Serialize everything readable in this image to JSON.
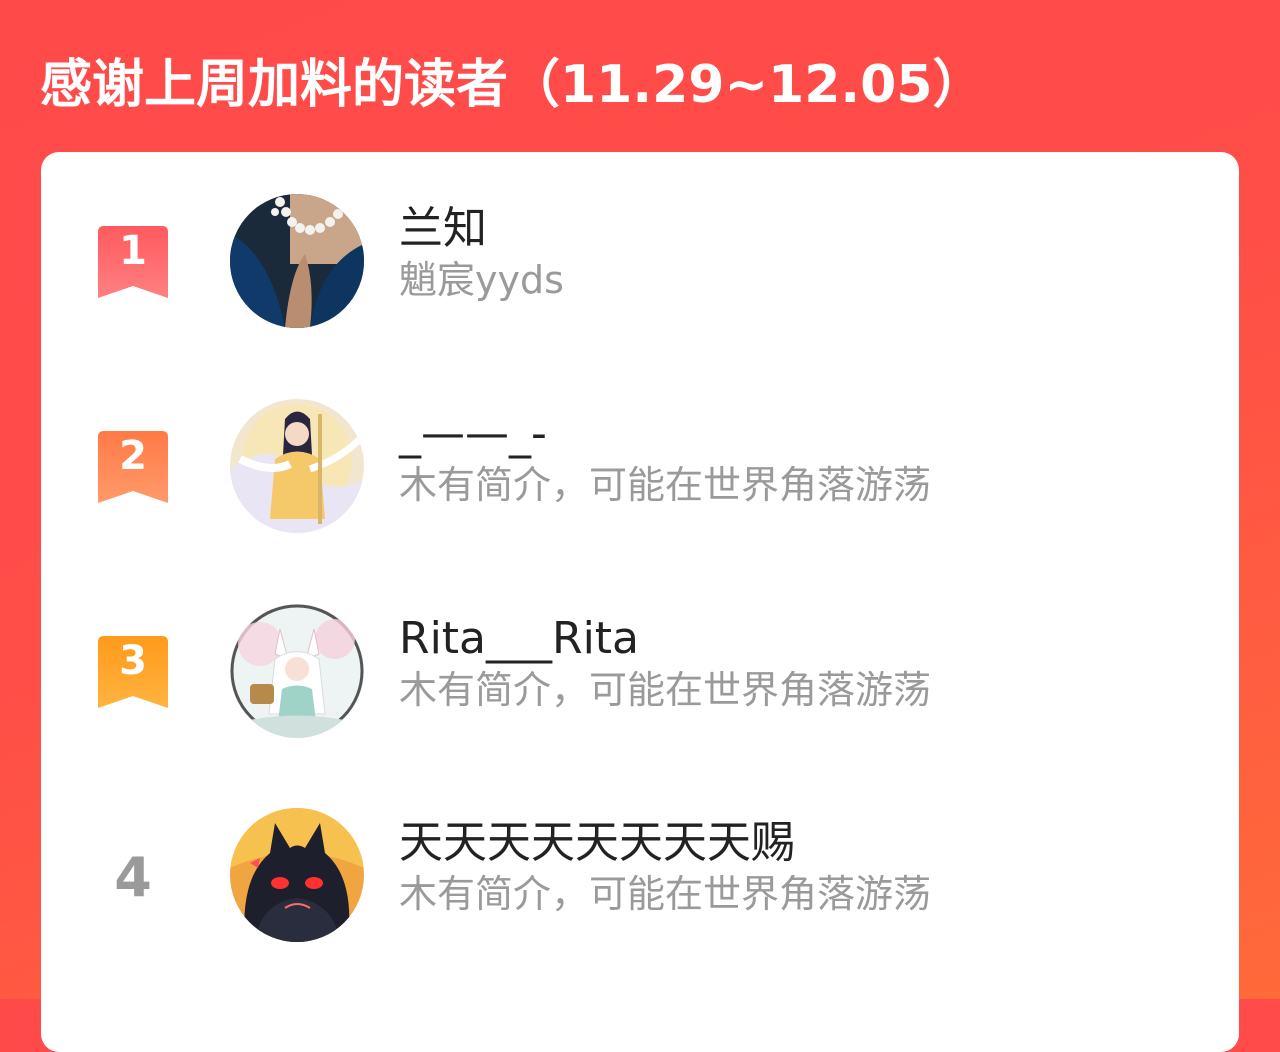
{
  "header": {
    "title": "感谢上周加料的读者（11.29~12.05）"
  },
  "colors": {
    "background": "#ff4a4a",
    "rank1": "#ff6b6b",
    "rank2": "#ff8a55",
    "rank3": "#ffa726",
    "rank_plain": "#9a9a9a"
  },
  "readers": [
    {
      "rank": "1",
      "name": "兰知",
      "bio": "魈宸yyds",
      "avatar_icon": "avatar-pearl-necklace-icon"
    },
    {
      "rank": "2",
      "name": "_——_-",
      "bio": "木有简介，可能在世界角落游荡",
      "avatar_icon": "avatar-anime-goddess-icon"
    },
    {
      "rank": "3",
      "name": "Rita___Rita",
      "bio": "木有简介，可能在世界角落游荡",
      "avatar_icon": "avatar-anime-fox-girl-icon"
    },
    {
      "rank": "4",
      "name": "天天天天天天天天赐",
      "bio": "木有简介，可能在世界角落游荡",
      "avatar_icon": "avatar-dark-creature-icon"
    }
  ]
}
